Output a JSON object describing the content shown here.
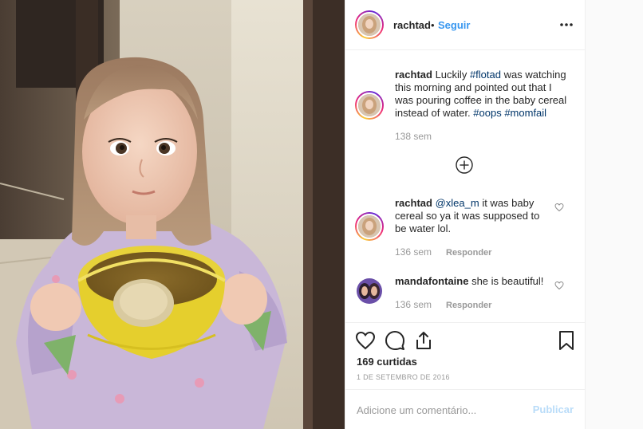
{
  "post": {
    "username": "rachtad",
    "separator": "•",
    "follow_label": "Seguir",
    "more_icon": "more-options-icon"
  },
  "caption": {
    "username": "rachtad",
    "text_part1": " Luckily ",
    "tag1": "#flotad",
    "text_part2": " was watching this morning and pointed out that I was pouring coffee in the baby cereal instead of water. ",
    "tag2": "#oops",
    "tag3": "#momfail",
    "time": "138 sem"
  },
  "load_more_icon": "plus-circle-icon",
  "comments": [
    {
      "username": "rachtad",
      "mention": "@xlea_m",
      "text": " it was baby cereal so ya it was supposed to be water lol.",
      "time": "136 sem",
      "reply_label": "Responder"
    },
    {
      "username": "mandafontaine",
      "text": " she is beautiful!",
      "time": "136 sem",
      "reply_label": "Responder"
    }
  ],
  "actions": {
    "icons": [
      "heart-icon",
      "comment-icon",
      "share-icon",
      "bookmark-icon"
    ],
    "likes": "169 curtidas",
    "date": "1 DE SETEMBRO DE 2016"
  },
  "add_comment": {
    "placeholder": "Adicione um comentário...",
    "publish_label": "Publicar"
  },
  "colors": {
    "link_blue": "#3897f0",
    "hashtag": "#003569",
    "muted": "#999999",
    "publish_disabled": "#b9dcf9"
  }
}
